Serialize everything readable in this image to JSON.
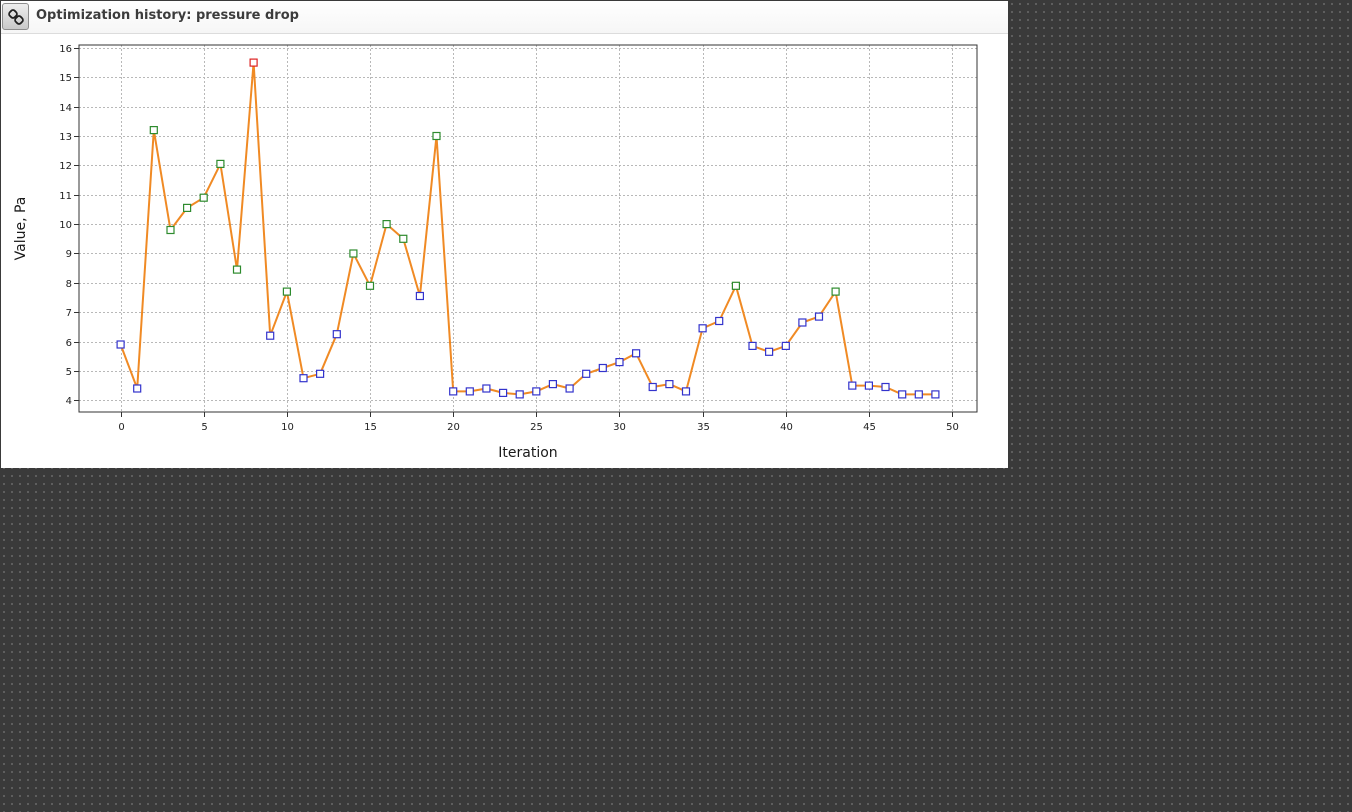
{
  "window": {
    "title": "Optimization history: pressure drop",
    "link_icon": "link-icon"
  },
  "colors": {
    "line": "#f08a24",
    "marker_low": "#3333cc",
    "marker_mid": "#2e8b2e",
    "marker_high": "#dd2222",
    "plot_border": "#333333",
    "grid": "#b8b8b8"
  },
  "chart_data": {
    "type": "line",
    "title": "",
    "xlabel": "Iteration",
    "ylabel": "Value, Pa",
    "xlim": [
      -2.5,
      51.5
    ],
    "ylim": [
      3.6,
      16.1
    ],
    "xticks": [
      0,
      5,
      10,
      15,
      20,
      25,
      30,
      35,
      40,
      45,
      50
    ],
    "yticks": [
      4,
      5,
      6,
      7,
      8,
      9,
      10,
      11,
      12,
      13,
      14,
      15,
      16
    ],
    "grid": true,
    "marker": "square",
    "series": [
      {
        "x": [
          0,
          1,
          2,
          3,
          4,
          5,
          6,
          7,
          8,
          9,
          10,
          11,
          12,
          13,
          14,
          15,
          16,
          17,
          18,
          19,
          20,
          21,
          22,
          23,
          24,
          25,
          26,
          27,
          28,
          29,
          30,
          31,
          32,
          33,
          34,
          35,
          36,
          37,
          38,
          39,
          40,
          41,
          42,
          43,
          44,
          45,
          46,
          47,
          48,
          49
        ],
        "values": [
          5.9,
          4.4,
          13.2,
          9.8,
          10.55,
          10.9,
          12.05,
          8.45,
          15.5,
          6.2,
          7.7,
          4.75,
          4.9,
          6.25,
          9.0,
          7.9,
          10.0,
          9.5,
          7.55,
          13.0,
          4.3,
          4.3,
          4.4,
          4.25,
          4.2,
          4.3,
          4.55,
          4.4,
          4.9,
          5.1,
          5.3,
          5.6,
          4.45,
          4.55,
          4.3,
          6.45,
          6.7,
          7.9,
          5.85,
          5.65,
          5.85,
          6.65,
          6.85,
          7.7,
          4.5,
          4.5,
          4.45,
          4.2,
          4.2,
          4.2
        ]
      }
    ]
  }
}
